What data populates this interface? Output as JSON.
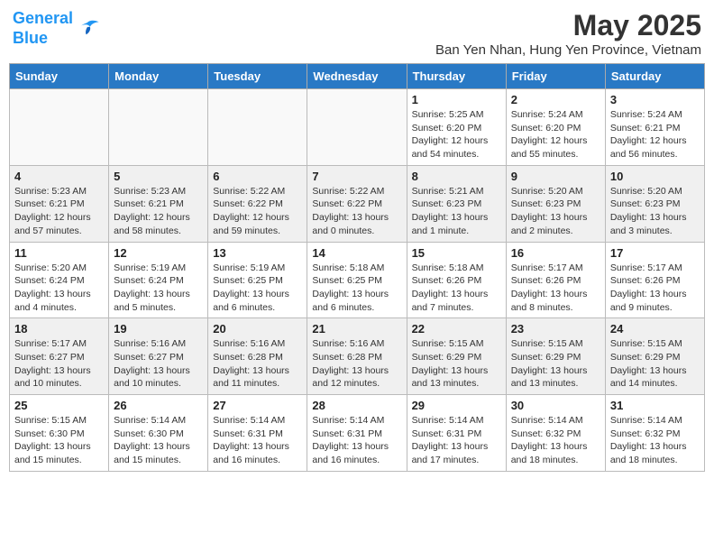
{
  "header": {
    "logo_line1": "General",
    "logo_line2": "Blue",
    "month_title": "May 2025",
    "location": "Ban Yen Nhan, Hung Yen Province, Vietnam"
  },
  "days_of_week": [
    "Sunday",
    "Monday",
    "Tuesday",
    "Wednesday",
    "Thursday",
    "Friday",
    "Saturday"
  ],
  "weeks": [
    [
      {
        "day": "",
        "info": ""
      },
      {
        "day": "",
        "info": ""
      },
      {
        "day": "",
        "info": ""
      },
      {
        "day": "",
        "info": ""
      },
      {
        "day": "1",
        "info": "Sunrise: 5:25 AM\nSunset: 6:20 PM\nDaylight: 12 hours\nand 54 minutes."
      },
      {
        "day": "2",
        "info": "Sunrise: 5:24 AM\nSunset: 6:20 PM\nDaylight: 12 hours\nand 55 minutes."
      },
      {
        "day": "3",
        "info": "Sunrise: 5:24 AM\nSunset: 6:21 PM\nDaylight: 12 hours\nand 56 minutes."
      }
    ],
    [
      {
        "day": "4",
        "info": "Sunrise: 5:23 AM\nSunset: 6:21 PM\nDaylight: 12 hours\nand 57 minutes."
      },
      {
        "day": "5",
        "info": "Sunrise: 5:23 AM\nSunset: 6:21 PM\nDaylight: 12 hours\nand 58 minutes."
      },
      {
        "day": "6",
        "info": "Sunrise: 5:22 AM\nSunset: 6:22 PM\nDaylight: 12 hours\nand 59 minutes."
      },
      {
        "day": "7",
        "info": "Sunrise: 5:22 AM\nSunset: 6:22 PM\nDaylight: 13 hours\nand 0 minutes."
      },
      {
        "day": "8",
        "info": "Sunrise: 5:21 AM\nSunset: 6:23 PM\nDaylight: 13 hours\nand 1 minute."
      },
      {
        "day": "9",
        "info": "Sunrise: 5:20 AM\nSunset: 6:23 PM\nDaylight: 13 hours\nand 2 minutes."
      },
      {
        "day": "10",
        "info": "Sunrise: 5:20 AM\nSunset: 6:23 PM\nDaylight: 13 hours\nand 3 minutes."
      }
    ],
    [
      {
        "day": "11",
        "info": "Sunrise: 5:20 AM\nSunset: 6:24 PM\nDaylight: 13 hours\nand 4 minutes."
      },
      {
        "day": "12",
        "info": "Sunrise: 5:19 AM\nSunset: 6:24 PM\nDaylight: 13 hours\nand 5 minutes."
      },
      {
        "day": "13",
        "info": "Sunrise: 5:19 AM\nSunset: 6:25 PM\nDaylight: 13 hours\nand 6 minutes."
      },
      {
        "day": "14",
        "info": "Sunrise: 5:18 AM\nSunset: 6:25 PM\nDaylight: 13 hours\nand 6 minutes."
      },
      {
        "day": "15",
        "info": "Sunrise: 5:18 AM\nSunset: 6:26 PM\nDaylight: 13 hours\nand 7 minutes."
      },
      {
        "day": "16",
        "info": "Sunrise: 5:17 AM\nSunset: 6:26 PM\nDaylight: 13 hours\nand 8 minutes."
      },
      {
        "day": "17",
        "info": "Sunrise: 5:17 AM\nSunset: 6:26 PM\nDaylight: 13 hours\nand 9 minutes."
      }
    ],
    [
      {
        "day": "18",
        "info": "Sunrise: 5:17 AM\nSunset: 6:27 PM\nDaylight: 13 hours\nand 10 minutes."
      },
      {
        "day": "19",
        "info": "Sunrise: 5:16 AM\nSunset: 6:27 PM\nDaylight: 13 hours\nand 10 minutes."
      },
      {
        "day": "20",
        "info": "Sunrise: 5:16 AM\nSunset: 6:28 PM\nDaylight: 13 hours\nand 11 minutes."
      },
      {
        "day": "21",
        "info": "Sunrise: 5:16 AM\nSunset: 6:28 PM\nDaylight: 13 hours\nand 12 minutes."
      },
      {
        "day": "22",
        "info": "Sunrise: 5:15 AM\nSunset: 6:29 PM\nDaylight: 13 hours\nand 13 minutes."
      },
      {
        "day": "23",
        "info": "Sunrise: 5:15 AM\nSunset: 6:29 PM\nDaylight: 13 hours\nand 13 minutes."
      },
      {
        "day": "24",
        "info": "Sunrise: 5:15 AM\nSunset: 6:29 PM\nDaylight: 13 hours\nand 14 minutes."
      }
    ],
    [
      {
        "day": "25",
        "info": "Sunrise: 5:15 AM\nSunset: 6:30 PM\nDaylight: 13 hours\nand 15 minutes."
      },
      {
        "day": "26",
        "info": "Sunrise: 5:14 AM\nSunset: 6:30 PM\nDaylight: 13 hours\nand 15 minutes."
      },
      {
        "day": "27",
        "info": "Sunrise: 5:14 AM\nSunset: 6:31 PM\nDaylight: 13 hours\nand 16 minutes."
      },
      {
        "day": "28",
        "info": "Sunrise: 5:14 AM\nSunset: 6:31 PM\nDaylight: 13 hours\nand 16 minutes."
      },
      {
        "day": "29",
        "info": "Sunrise: 5:14 AM\nSunset: 6:31 PM\nDaylight: 13 hours\nand 17 minutes."
      },
      {
        "day": "30",
        "info": "Sunrise: 5:14 AM\nSunset: 6:32 PM\nDaylight: 13 hours\nand 18 minutes."
      },
      {
        "day": "31",
        "info": "Sunrise: 5:14 AM\nSunset: 6:32 PM\nDaylight: 13 hours\nand 18 minutes."
      }
    ]
  ]
}
